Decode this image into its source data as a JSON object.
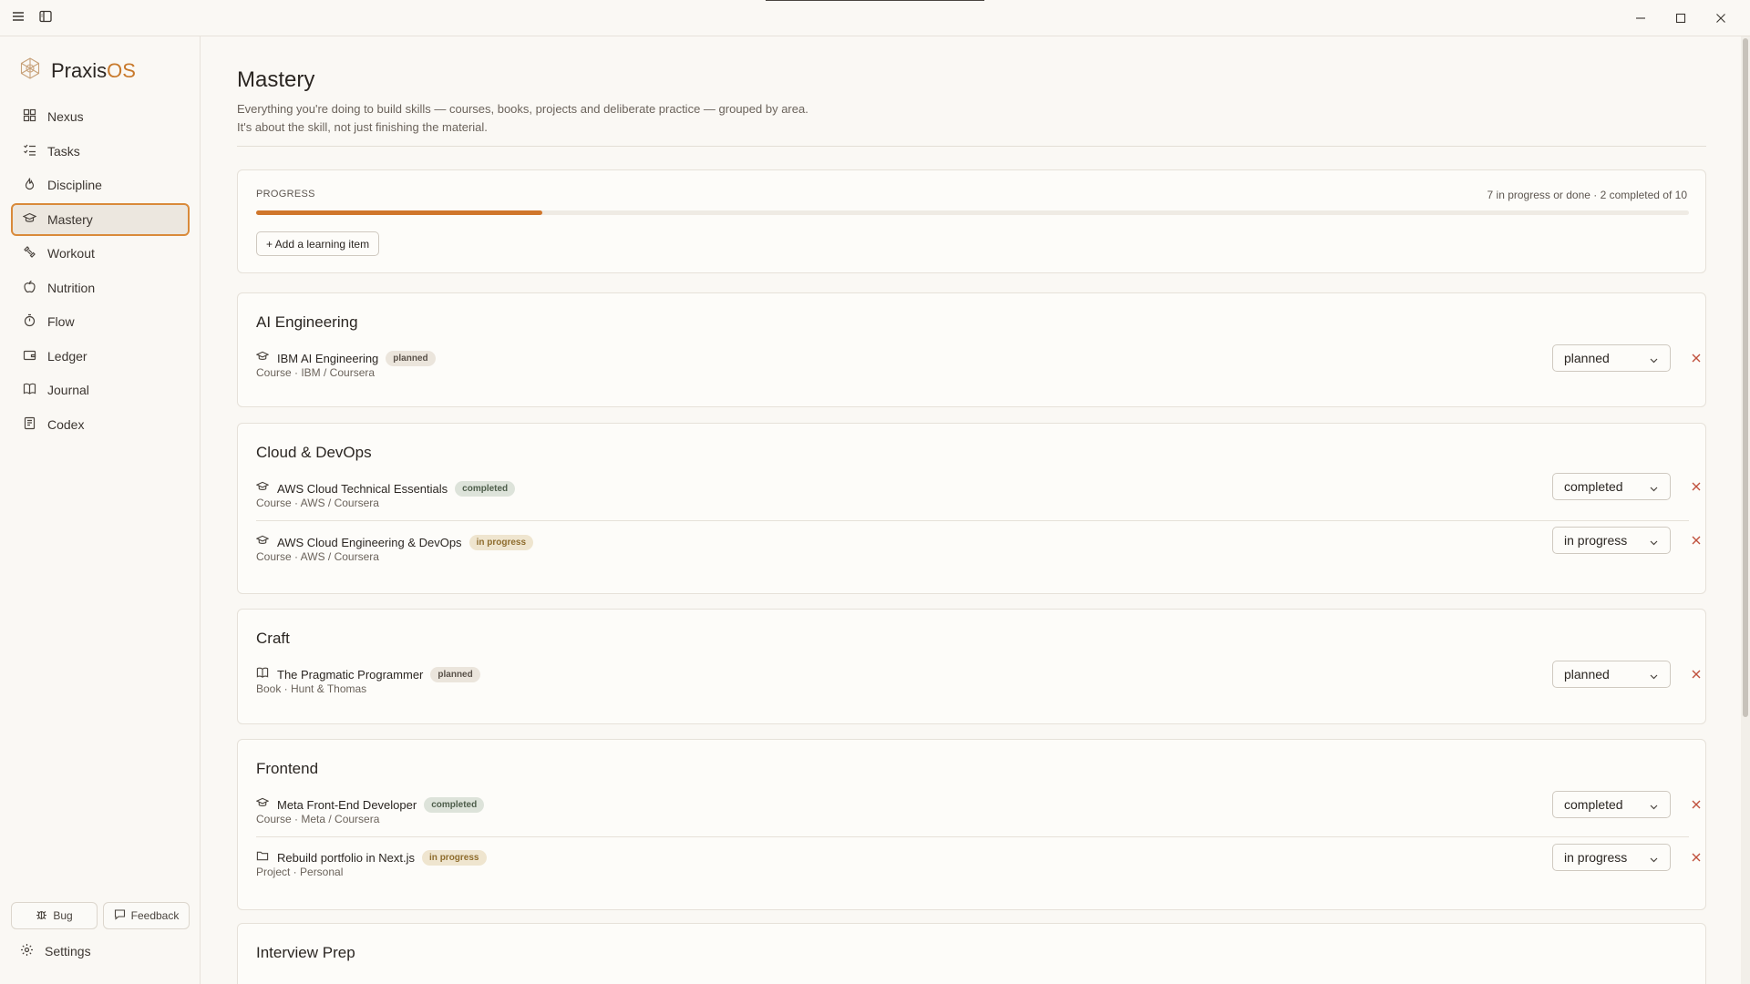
{
  "app": {
    "brand_main": "Praxis",
    "brand_accent": "OS"
  },
  "colors": {
    "accent": "#d0762b",
    "active_border": "#d98a3a",
    "remove": "#c0503c"
  },
  "sidebar": {
    "items": [
      {
        "label": "Nexus",
        "icon": "grid-icon"
      },
      {
        "label": "Tasks",
        "icon": "checklist-icon"
      },
      {
        "label": "Discipline",
        "icon": "flame-icon"
      },
      {
        "label": "Mastery",
        "icon": "graduation-cap-icon",
        "active": true
      },
      {
        "label": "Workout",
        "icon": "dumbbell-icon"
      },
      {
        "label": "Nutrition",
        "icon": "apple-icon"
      },
      {
        "label": "Flow",
        "icon": "timer-icon"
      },
      {
        "label": "Ledger",
        "icon": "wallet-icon"
      },
      {
        "label": "Journal",
        "icon": "book-icon"
      },
      {
        "label": "Codex",
        "icon": "notebook-icon"
      }
    ],
    "bug_label": "Bug",
    "feedback_label": "Feedback",
    "settings_label": "Settings"
  },
  "page": {
    "title": "Mastery",
    "description_line1": "Everything you're doing to build skills — courses, books, projects and deliberate practice — grouped by area.",
    "description_line2": "It's about the skill, not just finishing the material."
  },
  "progress": {
    "label": "PROGRESS",
    "summary": "7 in progress or done · 2 completed of 10",
    "fraction": 0.2,
    "add_label": "+ Add a learning item"
  },
  "groups": [
    {
      "title": "AI Engineering",
      "items": [
        {
          "title": "IBM AI Engineering",
          "badge": "planned",
          "meta": "Course · IBM / Coursera",
          "status": "planned",
          "icon": "graduation-cap-icon"
        }
      ]
    },
    {
      "title": "Cloud & DevOps",
      "items": [
        {
          "title": "AWS Cloud Technical Essentials",
          "badge": "completed",
          "meta": "Course · AWS / Coursera",
          "status": "completed",
          "icon": "graduation-cap-icon"
        },
        {
          "title": "AWS Cloud Engineering & DevOps",
          "badge": "in progress",
          "meta": "Course · AWS / Coursera",
          "status": "in progress",
          "icon": "graduation-cap-icon"
        }
      ]
    },
    {
      "title": "Craft",
      "items": [
        {
          "title": "The Pragmatic Programmer",
          "badge": "planned",
          "meta": "Book · Hunt & Thomas",
          "status": "planned",
          "icon": "book-open-icon"
        }
      ]
    },
    {
      "title": "Frontend",
      "items": [
        {
          "title": "Meta Front-End Developer",
          "badge": "completed",
          "meta": "Course · Meta / Coursera",
          "status": "completed",
          "icon": "graduation-cap-icon"
        },
        {
          "title": "Rebuild portfolio in Next.js",
          "badge": "in progress",
          "meta": "Project · Personal",
          "status": "in progress",
          "icon": "folder-icon"
        }
      ]
    },
    {
      "title": "Interview Prep",
      "items": []
    }
  ]
}
